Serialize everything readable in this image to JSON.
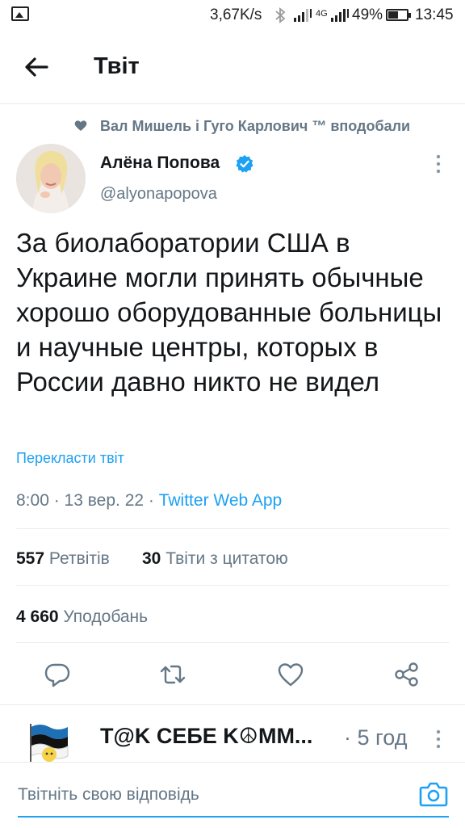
{
  "status_bar": {
    "speed": "3,67K/s",
    "network": "4G",
    "battery": "49%",
    "battery_level": 0.49,
    "time": "13:45"
  },
  "header": {
    "title": "Твіт"
  },
  "tweet": {
    "social_context": "Вал Мишель і Гуго Карлович ™ вподобали",
    "display_name": "Алёна Попова",
    "username": "@alyonapopova",
    "text": "За биолаборатории США в Украине могли принять обычные хорошо оборудованные больницы и научные центры, которых в России давно никто не видел",
    "translate_label": "Перекласти твіт",
    "time": "8:00",
    "date": "13 вер. 22",
    "source": "Twitter Web App",
    "retweets_count": "557",
    "retweets_label": "Ретвітів",
    "quotes_count": "30",
    "quotes_label": "Твіти з цитатою",
    "likes_count": "4 660",
    "likes_label": "Уподобань"
  },
  "next_tweet": {
    "display_name": "T@K CEБE K☮MM...",
    "time": "· 5 год"
  },
  "reply": {
    "placeholder": "Твітніть свою відповідь"
  },
  "colors": {
    "accent": "#1da1f2",
    "secondary_text": "#657786",
    "primary_text": "#14171a"
  },
  "icons": [
    "image-icon",
    "bluetooth-icon",
    "signal-icon",
    "battery-icon",
    "back-arrow-icon",
    "heart-icon",
    "verified-icon",
    "more-icon",
    "reply-icon",
    "retweet-icon",
    "like-icon",
    "share-icon",
    "camera-icon"
  ]
}
